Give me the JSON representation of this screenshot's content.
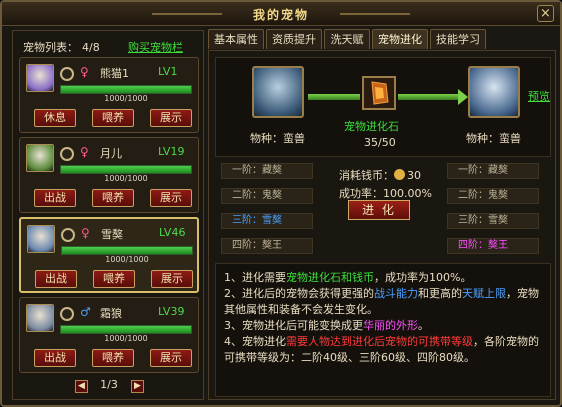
{
  "window": {
    "title": "我的宠物",
    "close_glyph": "×"
  },
  "list": {
    "label": "宠物列表：",
    "count": "4/8",
    "buy_link": "购买宠物栏"
  },
  "pets": [
    {
      "name": "熊猫1",
      "level": "LV1",
      "gender": "♀",
      "hp": "1000/1000",
      "hp_fraction": 1.0,
      "buttons": [
        "休息",
        "喂养",
        "展示"
      ],
      "selected": false,
      "avatar_color": "#8a6ec8"
    },
    {
      "name": "月儿",
      "level": "LV19",
      "gender": "♀",
      "hp": "1000/1000",
      "hp_fraction": 1.0,
      "buttons": [
        "出战",
        "喂养",
        "展示"
      ],
      "selected": false,
      "avatar_color": "#5a8a3a"
    },
    {
      "name": "雪獒",
      "level": "LV46",
      "gender": "♀",
      "hp": "1000/1000",
      "hp_fraction": 1.0,
      "buttons": [
        "出战",
        "喂养",
        "展示"
      ],
      "selected": true,
      "avatar_color": "#6a88b0"
    },
    {
      "name": "霜狼",
      "level": "LV39",
      "gender": "♂",
      "hp": "1000/1000",
      "hp_fraction": 1.0,
      "buttons": [
        "出战",
        "喂养",
        "展示"
      ],
      "selected": false,
      "avatar_color": "#7a8aa0"
    }
  ],
  "pager": {
    "text": "1/3",
    "prev": "◀",
    "next": "▶"
  },
  "tabs": [
    "基本属性",
    "资质提升",
    "洗天赋",
    "宠物进化",
    "技能学习"
  ],
  "active_tab": 3,
  "evolution": {
    "from_species": "物种：蛮兽",
    "to_species": "物种：蛮兽",
    "stone_label": "宠物进化石",
    "stone_count": "35/50",
    "preview": "预览"
  },
  "stages_left": [
    "一阶：藏獒",
    "二阶：鬼獒",
    "三阶：雪獒",
    "四阶：獒王"
  ],
  "stages_right": [
    "一阶：藏獒",
    "二阶：鬼獒",
    "三阶：雪獒",
    "四阶：獒王"
  ],
  "cost": {
    "label": "消耗钱币：",
    "value": "30",
    "rate_label": "成功率：",
    "rate": "100.00%"
  },
  "evolve_button": "进 化",
  "info": {
    "l1a": "1、进化需要",
    "l1b": "宠物进化石和钱币",
    "l1c": "，成功率为100%。",
    "l2a": "2、进化后的宠物会获得更强的",
    "l2b": "战斗能力",
    "l2c": "和更高的",
    "l2d": "天赋上限",
    "l2e": "，宠物其他属性和装备不会发生变化。",
    "l3a": "3、宠物进化后可能变换成更",
    "l3b": "华丽的外形",
    "l3c": "。",
    "l4a": "4、宠物进化",
    "l4b": "需要人物达到进化后宠物的可携带等级",
    "l4c": "，各阶宠物的可携带等级为：二阶40级、三阶60级、四阶80级。"
  }
}
